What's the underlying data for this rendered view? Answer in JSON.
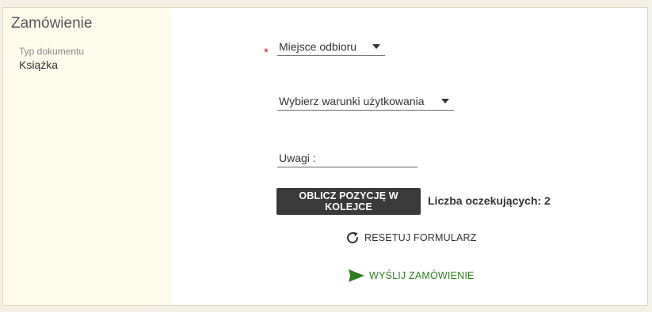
{
  "sidebar": {
    "title": "Zamówienie",
    "doc_type_label": "Typ dokumentu",
    "doc_type_value": "Książka"
  },
  "form": {
    "required_marker": "*",
    "pickup_place": {
      "label": "Miejsce odbioru"
    },
    "usage_terms": {
      "label": "Wybierz warunki użytkowania"
    },
    "notes": {
      "label": "Uwagi :"
    }
  },
  "actions": {
    "calc_queue_label": "OBLICZ POZYCJĘ W KOLEJCE",
    "queue_info": "Liczba oczekujących: 2",
    "reset_label": "RESETUJ FORMULARZ",
    "send_label": "WYŚLIJ ZAMÓWIENIE"
  },
  "icons": {
    "dropdown": "caret-down-icon",
    "reset": "refresh-icon",
    "send": "paper-plane-icon"
  },
  "colors": {
    "sidebar_bg": "#fdfbe9",
    "button_bg": "#3a3a3a",
    "required": "#cc2222",
    "send_accent": "#2e7d1e"
  }
}
